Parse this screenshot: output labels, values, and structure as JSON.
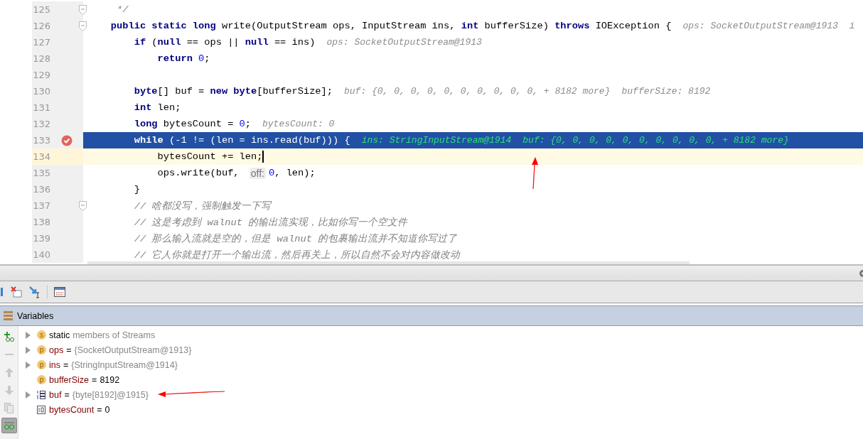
{
  "editor": {
    "lines": [
      {
        "number": "125",
        "breakpoint": false,
        "execution": false,
        "fold": true,
        "caret": false,
        "tokens": [
          {
            "kind": "comment",
            "text": "     */"
          }
        ]
      },
      {
        "number": "126",
        "breakpoint": false,
        "execution": false,
        "fold": true,
        "caret": false,
        "tokens": [
          {
            "kind": "keyword",
            "text": "    public static long "
          },
          {
            "kind": "plain",
            "text": "write(OutputStream ops, InputStream ins, "
          },
          {
            "kind": "keyword",
            "text": "int "
          },
          {
            "kind": "plain",
            "text": "bufferSize) "
          },
          {
            "kind": "keyword",
            "text": "throws "
          },
          {
            "kind": "plain",
            "text": "IOException {"
          },
          {
            "kind": "hint",
            "text": "ops: SocketOutputStream@1913"
          },
          {
            "kind": "hint",
            "text": "i"
          }
        ]
      },
      {
        "number": "127",
        "breakpoint": false,
        "execution": false,
        "fold": false,
        "caret": false,
        "tokens": [
          {
            "kind": "keyword",
            "text": "        if "
          },
          {
            "kind": "plain",
            "text": "("
          },
          {
            "kind": "keyword",
            "text": "null "
          },
          {
            "kind": "plain",
            "text": "== ops || "
          },
          {
            "kind": "keyword",
            "text": "null "
          },
          {
            "kind": "plain",
            "text": "== ins)"
          },
          {
            "kind": "hint",
            "text": "ops: SocketOutputStream@1913"
          }
        ]
      },
      {
        "number": "128",
        "breakpoint": false,
        "execution": false,
        "fold": false,
        "caret": false,
        "tokens": [
          {
            "kind": "keyword",
            "text": "            return "
          },
          {
            "kind": "number",
            "text": "0"
          },
          {
            "kind": "plain",
            "text": ";"
          }
        ]
      },
      {
        "number": "129",
        "breakpoint": false,
        "execution": false,
        "fold": false,
        "caret": false
      },
      {
        "number": "130",
        "breakpoint": false,
        "execution": false,
        "fold": false,
        "caret": false,
        "tokens": [
          {
            "kind": "keyword",
            "text": "        byte"
          },
          {
            "kind": "plain",
            "text": "[] buf = "
          },
          {
            "kind": "keyword",
            "text": "new byte"
          },
          {
            "kind": "plain",
            "text": "[bufferSize];"
          },
          {
            "kind": "hint",
            "text": "buf: {0, 0, 0, 0, 0, 0, 0, 0, 0, 0, + 8182 more}"
          },
          {
            "kind": "hint",
            "text": "bufferSize: 8192"
          }
        ]
      },
      {
        "number": "131",
        "breakpoint": false,
        "execution": false,
        "fold": false,
        "caret": false,
        "tokens": [
          {
            "kind": "keyword",
            "text": "        int "
          },
          {
            "kind": "plain",
            "text": "len;"
          }
        ]
      },
      {
        "number": "132",
        "breakpoint": false,
        "execution": false,
        "fold": false,
        "caret": false,
        "tokens": [
          {
            "kind": "keyword",
            "text": "        long "
          },
          {
            "kind": "plain",
            "text": "bytesCount = "
          },
          {
            "kind": "number",
            "text": "0"
          },
          {
            "kind": "plain",
            "text": ";"
          },
          {
            "kind": "hint",
            "text": "bytesCount: 0"
          }
        ]
      },
      {
        "number": "133",
        "breakpoint": true,
        "execution": true,
        "fold": false,
        "caret": false,
        "tokens": [
          {
            "kind": "keyword",
            "text": "        while "
          },
          {
            "kind": "plain",
            "text": "(-1 != (len = ins.read(buf))) {"
          },
          {
            "kind": "hint",
            "text": "ins: StringInputStream@1914"
          },
          {
            "kind": "hint",
            "text": "buf: {0, 0, 0, 0, 0, 0, 0, 0, 0, 0, + 8182 more}"
          }
        ]
      },
      {
        "number": "134",
        "breakpoint": false,
        "execution": false,
        "fold": false,
        "caret": true,
        "tokens": [
          {
            "kind": "plain",
            "text": "            bytesCount += len;"
          }
        ]
      },
      {
        "number": "135",
        "breakpoint": false,
        "execution": false,
        "fold": false,
        "caret": false,
        "tokens": [
          {
            "kind": "plain",
            "text": "            ops.write(buf, "
          },
          {
            "kind": "param-hint",
            "text": "off:"
          },
          {
            "kind": "number",
            "text": "0"
          },
          {
            "kind": "plain",
            "text": ", len);"
          }
        ]
      },
      {
        "number": "136",
        "breakpoint": false,
        "execution": false,
        "fold": false,
        "caret": false,
        "tokens": [
          {
            "kind": "plain",
            "text": "        }"
          }
        ]
      },
      {
        "number": "137",
        "breakpoint": false,
        "execution": false,
        "fold": true,
        "caret": false,
        "tokens": [
          {
            "kind": "comment",
            "text": "        // 啥都没写，强制触发一下写"
          }
        ]
      },
      {
        "number": "138",
        "breakpoint": false,
        "execution": false,
        "fold": false,
        "caret": false,
        "tokens": [
          {
            "kind": "comment",
            "text": "        // 这是考虑到 walnut 的输出流实现，比如你写一个空文件"
          }
        ]
      },
      {
        "number": "139",
        "breakpoint": false,
        "execution": false,
        "fold": false,
        "caret": false,
        "tokens": [
          {
            "kind": "comment",
            "text": "        // 那么输入流就是空的，但是 walnut 的包裹输出流并不知道你写过了"
          }
        ]
      },
      {
        "number": "140",
        "breakpoint": false,
        "execution": false,
        "fold": false,
        "caret": false,
        "tokens": [
          {
            "kind": "comment",
            "text": "        // 它人你就是打开一个输出流，然后再关上，所以自然不会对内容做改动"
          }
        ]
      }
    ]
  },
  "variables": {
    "title": "Variables",
    "rows": [
      {
        "kind": "static",
        "badge": "s",
        "expandable": true,
        "name": "static",
        "value": "members of Streams",
        "value_dimmed": true
      },
      {
        "kind": "param",
        "badge": "p",
        "expandable": true,
        "name": "ops",
        "separator": "=",
        "value": "{SocketOutputStream@1913}",
        "value_dimmed": true
      },
      {
        "kind": "param",
        "badge": "p",
        "expandable": true,
        "name": "ins",
        "separator": "=",
        "value": "{StringInputStream@1914}",
        "value_dimmed": true
      },
      {
        "kind": "param",
        "badge": "p",
        "expandable": false,
        "name": "bufferSize",
        "separator": "=",
        "value": "8192",
        "value_dimmed": false
      },
      {
        "kind": "array",
        "expandable": true,
        "name": "buf",
        "separator": "=",
        "value": "{byte[8192]@1915}",
        "value_dimmed": true
      },
      {
        "kind": "primitive",
        "expandable": false,
        "name": "bytesCount",
        "separator": "=",
        "value": "0",
        "value_dimmed": false
      }
    ]
  }
}
